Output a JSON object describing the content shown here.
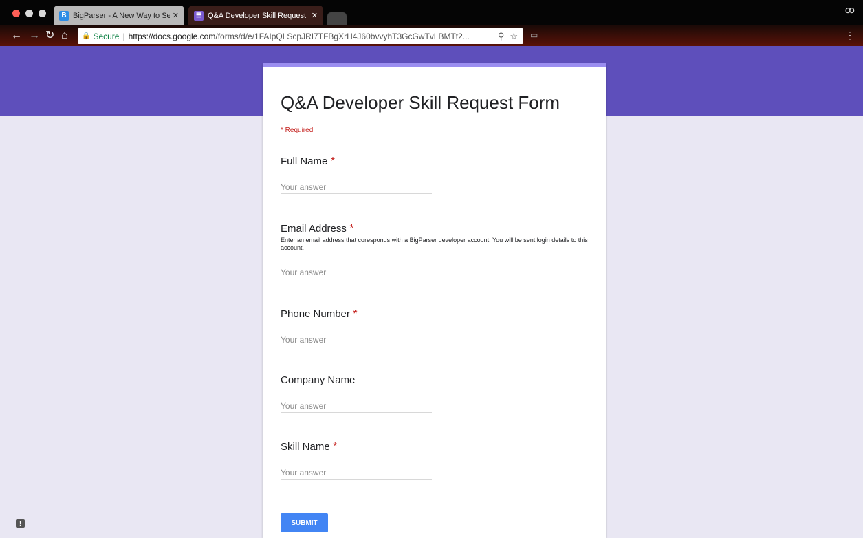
{
  "browser": {
    "tabs": [
      {
        "title": "BigParser - A New Way to Sea",
        "favicon": "B",
        "active": false
      },
      {
        "title": "Q&A Developer Skill Request F",
        "active": true
      }
    ],
    "address": {
      "secure_label": "Secure",
      "host": "https://docs.google.com",
      "path": "/forms/d/e/1FAIpQLScpJRI7TFBgXrH4J60bvvyhT3GcGwTvLBMTt2..."
    },
    "icons": [
      "back-icon",
      "forward-icon",
      "reload-icon",
      "home-icon",
      "lock-icon",
      "zoom-icon",
      "star-icon",
      "cast-icon",
      "menu-icon",
      "incognito-icon"
    ]
  },
  "form": {
    "title": "Q&A Developer Skill Request Form",
    "required_note": "* Required",
    "required_mark": "*",
    "questions": [
      {
        "label": "Full Name",
        "required": true,
        "placeholder": "Your answer"
      },
      {
        "label": "Email Address",
        "required": true,
        "description": "Enter an email address that coresponds with a BigParser developer account. You will be sent login details to this account.",
        "placeholder": "Your answer"
      },
      {
        "label": "Phone Number",
        "required": true,
        "placeholder": "Your answer"
      },
      {
        "label": "Company Name",
        "required": false,
        "placeholder": "Your answer"
      },
      {
        "label": "Skill Name",
        "required": true,
        "placeholder": "Your answer"
      }
    ],
    "submit_label": "SUBMIT"
  },
  "colors": {
    "banner": "#5e4fbb",
    "page_background": "#e9e7f3",
    "accent": "#9b8ef0",
    "submit": "#4285f4",
    "required": "#c5221f"
  }
}
